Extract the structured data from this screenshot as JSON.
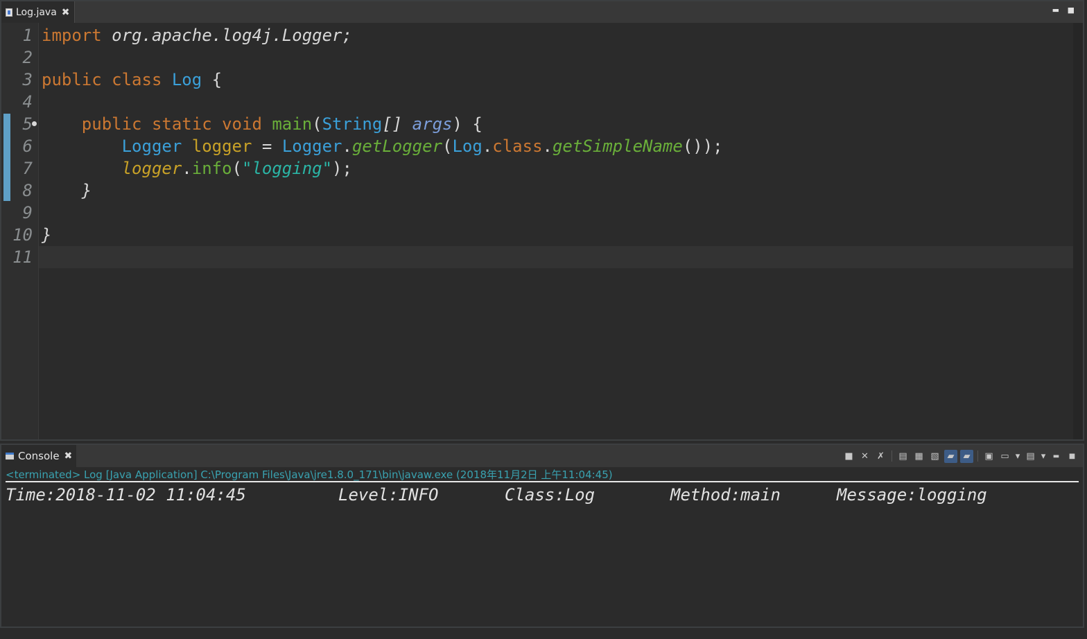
{
  "editor": {
    "tab_label": "Log.java",
    "tab_close": "✖",
    "minimize": "▬",
    "maximize": "■",
    "line_numbers": [
      "1",
      "2",
      "3",
      "4",
      "5",
      "6",
      "7",
      "8",
      "9",
      "10",
      "11"
    ],
    "code": {
      "l1_import": "import",
      "l1_pkg": " org.apache.log4j.Logger;",
      "l3_public": "public",
      "l3_class": " class",
      "l3_name": " Log",
      "l3_brace": " {",
      "l5_indent": "    ",
      "l5_public": "public",
      "l5_static": " static",
      "l5_void": " void",
      "l5_main": " main",
      "l5_paren": "(",
      "l5_string": "String",
      "l5_arr": "[] ",
      "l5_args": "args",
      "l5_close": ") {",
      "l6_indent": "        ",
      "l6_type": "Logger",
      "l6_var": " logger",
      "l6_eq": " = ",
      "l6_cls": "Logger",
      "l6_dot": ".",
      "l6_get": "getLogger",
      "l6_p1": "(",
      "l6_log": "Log",
      "l6_dot2": ".",
      "l6_classkw": "class",
      "l6_dot3": ".",
      "l6_simple": "getSimpleName",
      "l6_end": "());",
      "l7_indent": "        ",
      "l7_var": "logger",
      "l7_dot": ".",
      "l7_info": "info",
      "l7_p": "(",
      "l7_str": "\"logging\"",
      "l7_end": ");",
      "l8": "    }",
      "l10": "}"
    }
  },
  "console": {
    "tab_label": "Console",
    "tab_close": "✖",
    "status": "<terminated> Log [Java Application] C:\\Program Files\\Java\\jre1.8.0_171\\bin\\javaw.exe (2018年11月2日 上午11:04:45)",
    "output": {
      "time": "Time:2018-11-02 11:04:45",
      "level": "Level:INFO",
      "class": "Class:Log",
      "method": "Method:main",
      "message": "Message:logging"
    },
    "toolbar_icons": [
      "terminate-icon",
      "remove-launch-icon",
      "remove-all-terminated-icon",
      "clear-console-icon",
      "scroll-lock-icon",
      "word-wrap-icon",
      "show-on-stdout-icon",
      "show-on-stderr-icon",
      "pin-console-icon",
      "display-selected-console-icon",
      "open-console-icon"
    ]
  }
}
